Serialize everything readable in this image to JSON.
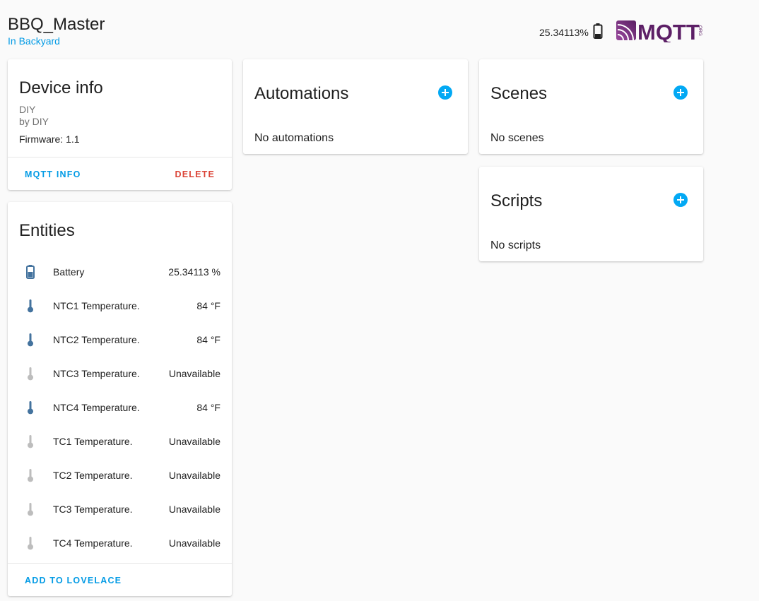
{
  "device": {
    "name": "BBQ_Master",
    "area": "In Backyard",
    "battery_text": "25.34113%",
    "logo_text": "MQTT",
    "logo_suffix": "ORG"
  },
  "device_info": {
    "title": "Device info",
    "model": "DIY",
    "manufacturer": "by DIY",
    "firmware": "Firmware: 1.1",
    "mqtt_info_label": "MQTT INFO",
    "delete_label": "DELETE"
  },
  "entities": {
    "title": "Entities",
    "items": [
      {
        "name": "Battery",
        "state": "25.34113 %",
        "icon": "battery-icon",
        "available": true
      },
      {
        "name": "NTC1 Temperature.",
        "state": "84 °F",
        "icon": "thermometer-icon",
        "available": true
      },
      {
        "name": "NTC2 Temperature.",
        "state": "84 °F",
        "icon": "thermometer-icon",
        "available": true
      },
      {
        "name": "NTC3 Temperature.",
        "state": "Unavailable",
        "icon": "thermometer-icon",
        "available": false
      },
      {
        "name": "NTC4 Temperature.",
        "state": "84 °F",
        "icon": "thermometer-icon",
        "available": true
      },
      {
        "name": "TC1 Temperature.",
        "state": "Unavailable",
        "icon": "thermometer-icon",
        "available": false
      },
      {
        "name": "TC2 Temperature.",
        "state": "Unavailable",
        "icon": "thermometer-icon",
        "available": false
      },
      {
        "name": "TC3 Temperature.",
        "state": "Unavailable",
        "icon": "thermometer-icon",
        "available": false
      },
      {
        "name": "TC4 Temperature.",
        "state": "Unavailable",
        "icon": "thermometer-icon",
        "available": false
      }
    ],
    "add_label": "ADD TO LOVELACE"
  },
  "automations": {
    "title": "Automations",
    "empty": "No automations"
  },
  "scenes": {
    "title": "Scenes",
    "empty": "No scenes"
  },
  "scripts": {
    "title": "Scripts",
    "empty": "No scripts"
  },
  "colors": {
    "primary": "#03a9f4",
    "link": "#039be5",
    "delete": "#db4437",
    "icon_active": "#44739e",
    "icon_unavailable": "#bdbdbd",
    "secondary_text": "#727272"
  }
}
